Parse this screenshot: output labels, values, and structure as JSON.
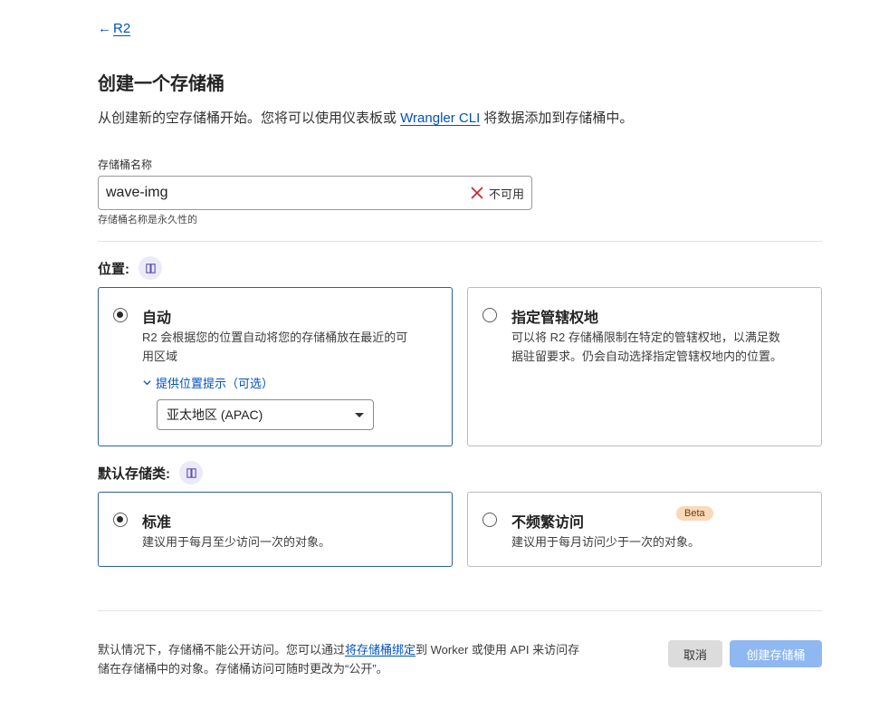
{
  "breadcrumb": {
    "back_label": "R2"
  },
  "page": {
    "title": "创建一个存储桶",
    "intro_before": "从创建新的空存储桶开始。您将可以使用仪表板或 ",
    "intro_link": "Wrangler CLI",
    "intro_after": " 将数据添加到存储桶中。"
  },
  "bucket_name": {
    "label": "存储桶名称",
    "value": "wave-img",
    "status": "不可用",
    "hint": "存储桶名称是永久性的"
  },
  "location": {
    "label": "位置:",
    "options": [
      {
        "title": "自动",
        "desc_line1": "R2 会根据您的位置自动将您的存储桶放在最近的可",
        "desc_line2": "用区域",
        "hint_toggle": "提供位置提示（可选）",
        "select_value": "亚太地区 (APAC)",
        "selected": true
      },
      {
        "title": "指定管辖权地",
        "desc_line1": "可以将 R2 存储桶限制在特定的管辖权地，以满足数",
        "desc_line2": "据驻留要求。仍会自动选择指定管辖权地内的位置。",
        "selected": false
      }
    ]
  },
  "storage_class": {
    "label": "默认存储类:",
    "options": [
      {
        "title": "标准",
        "desc": "建议用于每月至少访问一次的对象。",
        "selected": true
      },
      {
        "title": "不频繁访问",
        "badge": "Beta",
        "desc": "建议用于每月访问少于一次的对象。",
        "selected": false
      }
    ]
  },
  "footer": {
    "note_before": "默认情况下，存储桶不能公开访问。您可以通过",
    "note_link": "将存储桶绑定",
    "note_after": "到 Worker 或使用 API 来访问存储在存储桶中的对象。存储桶访问可随时更改为“公开”。",
    "cancel_label": "取消",
    "create_label": "创建存储桶"
  },
  "colors": {
    "link": "#0051c3",
    "selected_border": "#2c5ea5",
    "error_icon": "#c8232c",
    "create_button_disabled": "#8fb8f2",
    "beta_badge": "#fad8b8"
  }
}
